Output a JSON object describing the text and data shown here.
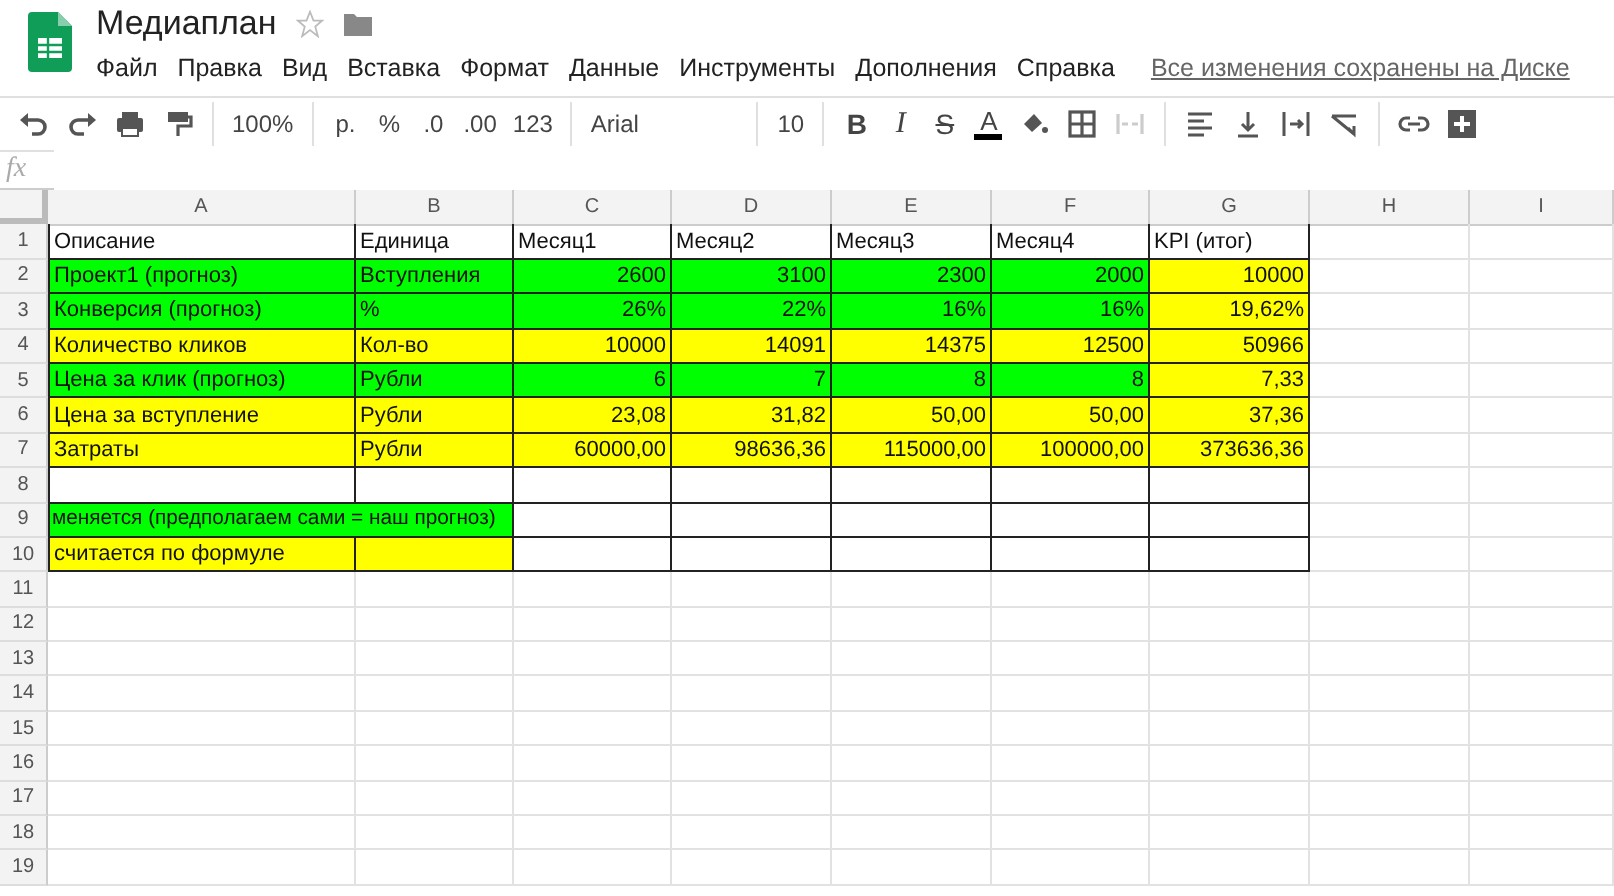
{
  "document": {
    "title": "Медиаплан",
    "starred": false
  },
  "menu": [
    "Файл",
    "Правка",
    "Вид",
    "Вставка",
    "Формат",
    "Данные",
    "Инструменты",
    "Дополнения",
    "Справка"
  ],
  "save_status": "Все изменения сохранены на Диске",
  "toolbar": [
    {
      "kind": "undo"
    },
    {
      "kind": "redo"
    },
    {
      "kind": "print"
    },
    {
      "kind": "paint"
    },
    {
      "kind": "sep"
    },
    {
      "kind": "dropdown",
      "label": "100%"
    },
    {
      "kind": "sep"
    },
    {
      "kind": "text",
      "label": "р."
    },
    {
      "kind": "text",
      "label": "%"
    },
    {
      "kind": "text",
      "label": ".0"
    },
    {
      "kind": "text",
      "label": ".00"
    },
    {
      "kind": "dropdown",
      "label": "123"
    },
    {
      "kind": "sep"
    },
    {
      "kind": "font",
      "label": "Arial"
    },
    {
      "kind": "sep"
    },
    {
      "kind": "dropdown",
      "label": "10"
    },
    {
      "kind": "sep"
    },
    {
      "kind": "bold",
      "label": "B"
    },
    {
      "kind": "italic",
      "label": "I"
    },
    {
      "kind": "strike",
      "label": "S"
    },
    {
      "kind": "textcolor",
      "label": "A"
    },
    {
      "kind": "fill"
    },
    {
      "kind": "borders"
    },
    {
      "kind": "merge"
    },
    {
      "kind": "sep"
    },
    {
      "kind": "align"
    },
    {
      "kind": "valign"
    },
    {
      "kind": "wrap"
    },
    {
      "kind": "rotate"
    },
    {
      "kind": "sep"
    },
    {
      "kind": "link"
    },
    {
      "kind": "comment"
    }
  ],
  "formula_bar": {
    "label": "fx"
  },
  "columns": [
    "A",
    "B",
    "C",
    "D",
    "E",
    "F",
    "G",
    "H",
    "I"
  ],
  "rows": [
    {
      "number": "1",
      "bordered": true,
      "cells": [
        {
          "text": "Описание",
          "kind": "text"
        },
        {
          "text": "Единица",
          "kind": "text"
        },
        {
          "text": "Месяц1",
          "kind": "text"
        },
        {
          "text": "Месяц2",
          "kind": "text"
        },
        {
          "text": "Месяц3",
          "kind": "text"
        },
        {
          "text": "Месяц4",
          "kind": "text"
        },
        {
          "text": "KPI (итог)",
          "kind": "text"
        }
      ]
    },
    {
      "number": "2",
      "bordered": true,
      "cells": [
        {
          "text": "Проект1 (прогноз)",
          "kind": "text",
          "color": "#00ff00"
        },
        {
          "text": "Вступления",
          "kind": "text",
          "color": "#00ff00"
        },
        {
          "text": "2600",
          "kind": "number",
          "color": "#00ff00"
        },
        {
          "text": "3100",
          "kind": "number",
          "color": "#00ff00"
        },
        {
          "text": "2300",
          "kind": "number",
          "color": "#00ff00"
        },
        {
          "text": "2000",
          "kind": "number",
          "color": "#00ff00"
        },
        {
          "text": "10000",
          "kind": "number",
          "color": "#ffff00"
        }
      ]
    },
    {
      "number": "3",
      "bordered": true,
      "cells": [
        {
          "text": "Конверсия (прогноз)",
          "kind": "text",
          "color": "#00ff00"
        },
        {
          "text": "%",
          "kind": "text",
          "color": "#00ff00"
        },
        {
          "text": "26%",
          "kind": "number",
          "color": "#00ff00"
        },
        {
          "text": "22%",
          "kind": "number",
          "color": "#00ff00"
        },
        {
          "text": "16%",
          "kind": "number",
          "color": "#00ff00"
        },
        {
          "text": "16%",
          "kind": "number",
          "color": "#00ff00"
        },
        {
          "text": "19,62%",
          "kind": "number",
          "color": "#ffff00"
        }
      ]
    },
    {
      "number": "4",
      "bordered": true,
      "cells": [
        {
          "text": "Количество кликов",
          "kind": "text",
          "color": "#ffff00"
        },
        {
          "text": "Кол-во",
          "kind": "text",
          "color": "#ffff00"
        },
        {
          "text": "10000",
          "kind": "number",
          "color": "#ffff00"
        },
        {
          "text": "14091",
          "kind": "number",
          "color": "#ffff00"
        },
        {
          "text": "14375",
          "kind": "number",
          "color": "#ffff00"
        },
        {
          "text": "12500",
          "kind": "number",
          "color": "#ffff00"
        },
        {
          "text": "50966",
          "kind": "number",
          "color": "#ffff00"
        }
      ]
    },
    {
      "number": "5",
      "bordered": true,
      "cells": [
        {
          "text": "Цена за клик (прогноз)",
          "kind": "text",
          "color": "#00ff00"
        },
        {
          "text": "Рубли",
          "kind": "text",
          "color": "#00ff00"
        },
        {
          "text": "6",
          "kind": "number",
          "color": "#00ff00"
        },
        {
          "text": "7",
          "kind": "number",
          "color": "#00ff00"
        },
        {
          "text": "8",
          "kind": "number",
          "color": "#00ff00"
        },
        {
          "text": "8",
          "kind": "number",
          "color": "#00ff00"
        },
        {
          "text": "7,33",
          "kind": "number",
          "color": "#ffff00"
        }
      ]
    },
    {
      "number": "6",
      "bordered": true,
      "cells": [
        {
          "text": "Цена за вступление",
          "kind": "text",
          "color": "#ffff00"
        },
        {
          "text": "Рубли",
          "kind": "text",
          "color": "#ffff00"
        },
        {
          "text": "23,08",
          "kind": "number",
          "color": "#ffff00"
        },
        {
          "text": "31,82",
          "kind": "number",
          "color": "#ffff00"
        },
        {
          "text": "50,00",
          "kind": "number",
          "color": "#ffff00"
        },
        {
          "text": "50,00",
          "kind": "number",
          "color": "#ffff00"
        },
        {
          "text": "37,36",
          "kind": "number",
          "color": "#ffff00"
        }
      ]
    },
    {
      "number": "7",
      "bordered": true,
      "cells": [
        {
          "text": "Затраты",
          "kind": "text",
          "color": "#ffff00"
        },
        {
          "text": "Рубли",
          "kind": "text",
          "color": "#ffff00"
        },
        {
          "text": "60000,00",
          "kind": "number",
          "color": "#ffff00"
        },
        {
          "text": "98636,36",
          "kind": "number",
          "color": "#ffff00"
        },
        {
          "text": "115000,00",
          "kind": "number",
          "color": "#ffff00"
        },
        {
          "text": "100000,00",
          "kind": "number",
          "color": "#ffff00"
        },
        {
          "text": "373636,36",
          "kind": "number",
          "color": "#ffff00"
        }
      ]
    },
    {
      "number": "8",
      "bordered": true,
      "cells": []
    },
    {
      "number": "9",
      "bordered": true,
      "cells": [
        {
          "text": "меняется (предполагаем сами = наш прогноз)",
          "kind": "merged",
          "color": "#00ff00"
        }
      ]
    },
    {
      "number": "10",
      "bordered": true,
      "cells": [
        {
          "text": "считается по формуле",
          "kind": "text",
          "color": "#ffff00"
        },
        {
          "kind": "empty",
          "color": "#ffff00"
        }
      ]
    },
    {
      "number": "11",
      "bordered": false,
      "cells": []
    },
    {
      "number": "12",
      "bordered": false,
      "cells": []
    },
    {
      "number": "13",
      "bordered": false,
      "cells": []
    },
    {
      "number": "14",
      "bordered": false,
      "cells": []
    },
    {
      "number": "15",
      "bordered": false,
      "cells": []
    },
    {
      "number": "16",
      "bordered": false,
      "cells": []
    },
    {
      "number": "17",
      "bordered": false,
      "cells": []
    },
    {
      "number": "18",
      "bordered": false,
      "cells": []
    },
    {
      "number": "19",
      "bordered": false,
      "cells": []
    }
  ]
}
